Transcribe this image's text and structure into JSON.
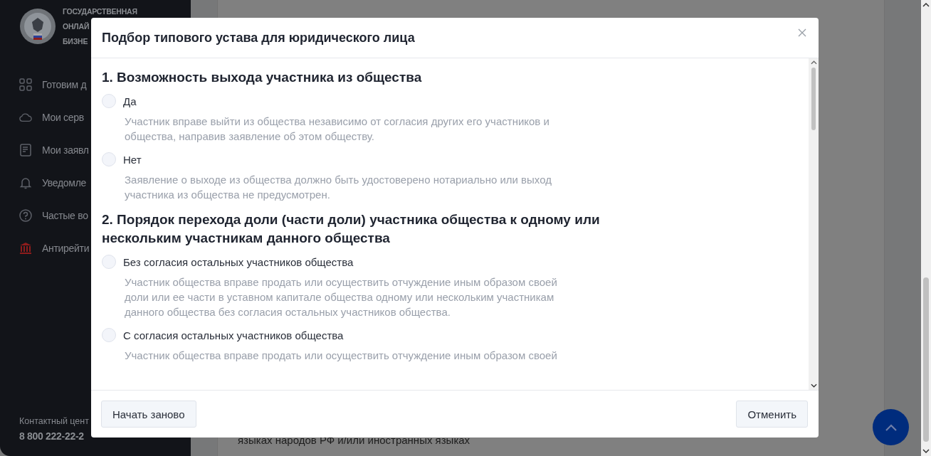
{
  "sidebar": {
    "logo_lines": [
      "ГОСУДАРСТВЕННАЯ",
      "ОНЛАЙ",
      "БИЗНЕ"
    ],
    "items": [
      {
        "kind": "grid",
        "label": "Готовим д"
      },
      {
        "kind": "cloud",
        "label": "Мои серв"
      },
      {
        "kind": "document",
        "label": "Мои заявл"
      },
      {
        "kind": "bell",
        "label": "Уведомле"
      },
      {
        "kind": "question",
        "label": "Частые во"
      },
      {
        "kind": "bank",
        "label": "Антирейти"
      }
    ],
    "contact_label": "Контактный цент",
    "contact_phone": "8 800 222-22-2"
  },
  "page": {
    "bottom_text": "языках народов РФ и/или иностранных языках"
  },
  "modal": {
    "title": "Подбор типового устава для юридического лица",
    "questions": [
      {
        "title": "1. Возможность выхода участника из общества",
        "options": [
          {
            "label": "Да",
            "selected": false,
            "description": "Участник вправе выйти из общества независимо от согласия других его участников и общества, направив заявление об этом обществу."
          },
          {
            "label": "Нет",
            "selected": false,
            "description": "Заявление о выходе из общества должно быть удостоверено нотариально или выход участника из общества не предусмотрен."
          }
        ]
      },
      {
        "title": "2. Порядок перехода доли (части доли) участника общества к одному или нескольким участникам данного общества",
        "options": [
          {
            "label": "Без согласия остальных участников общества",
            "selected": false,
            "description": "Участник общества вправе продать или осуществить отчуждение иным образом своей доли или ее части в уставном капитале общества одному или нескольким участникам данного общества без согласия остальных участников общества."
          },
          {
            "label": "С согласия остальных участников общества",
            "selected": false,
            "description": "Участник общества вправе продать или осуществить отчуждение иным образом своей"
          }
        ]
      }
    ],
    "buttons": [
      {
        "kind": "secondary",
        "label": "Начать заново"
      },
      {
        "kind": "secondary",
        "label": "Отменить"
      }
    ]
  }
}
